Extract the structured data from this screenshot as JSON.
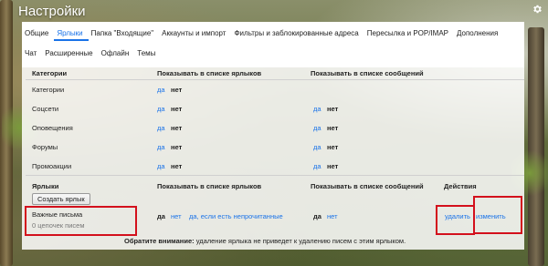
{
  "app": {
    "title": "Настройки",
    "settings_icon": "gear-icon"
  },
  "tabs_row1": [
    "Общие",
    "Ярлыки",
    "Папка \"Входящие\"",
    "Аккаунты и импорт",
    "Фильтры и заблокированные адреса",
    "Пересылка и POP/IMAP",
    "Дополнения"
  ],
  "tabs_row2": [
    "Чат",
    "Расширенные",
    "Офлайн",
    "Темы"
  ],
  "active_tab": "Ярлыки",
  "system_section": {
    "headers": {
      "col1": "Категории",
      "col2": "Показывать в списке ярлыков",
      "col3": "Показывать в списке сообщений"
    },
    "rows": [
      {
        "name": "Категории",
        "show_label": "да",
        "hide_label": "нет",
        "msg_show": "",
        "msg_hide": ""
      },
      {
        "name": "Соцсети",
        "show_label": "да",
        "hide_label": "нет",
        "msg_show": "да",
        "msg_hide": "нет"
      },
      {
        "name": "Оповещения",
        "show_label": "да",
        "hide_label": "нет",
        "msg_show": "да",
        "msg_hide": "нет"
      },
      {
        "name": "Форумы",
        "show_label": "да",
        "hide_label": "нет",
        "msg_show": "да",
        "msg_hide": "нет"
      },
      {
        "name": "Промоакции",
        "show_label": "да",
        "hide_label": "нет",
        "msg_show": "да",
        "msg_hide": "нет"
      }
    ]
  },
  "labels_section": {
    "headers": {
      "col1": "Ярлыки",
      "col2": "Показывать в списке ярлыков",
      "col3": "Показывать в списке сообщений",
      "col4": "Действия"
    },
    "create_button": "Создать ярлык",
    "label": {
      "name": "Важные письма",
      "count": "0 цепочек писем",
      "show_yes": "да",
      "show_no": "нет",
      "show_unread": "да, если есть непрочитанные",
      "msg_show": "да",
      "msg_hide": "нет",
      "delete": "удалить",
      "edit": "изменить"
    }
  },
  "note": {
    "strong": "Обратите внимание:",
    "text": " удаление ярлыка не приведет к удалению писем с этим ярлыком."
  },
  "colors": {
    "accent": "#1a73e8",
    "highlight": "#d3101c"
  }
}
